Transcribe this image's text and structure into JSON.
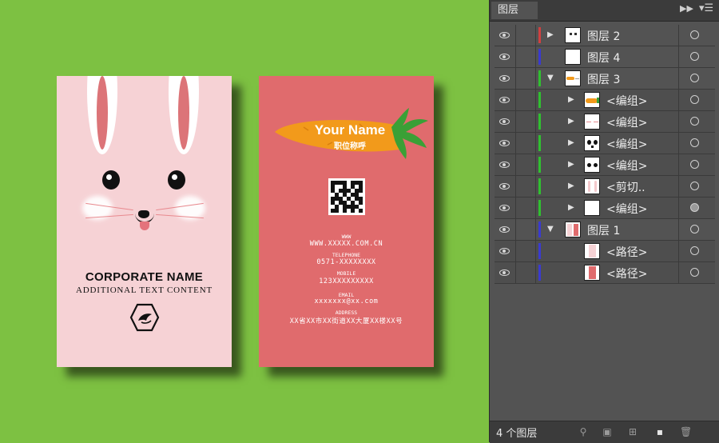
{
  "canvas": {
    "background_color": "#7dc142",
    "front_card": {
      "background_color": "#f6d2d5",
      "company_name": "CORPORATE NAME",
      "company_sub": "ADDITIONAL TEXT CONTENT"
    },
    "back_card": {
      "background_color": "#e06b6d",
      "name": "Your Name",
      "job_title": "职位称呼",
      "www_label": "WWW",
      "www_value": "WWW.XXXXX.COM.CN",
      "telephone_label": "TELEPHONE",
      "telephone_value": "0571-XXXXXXXX",
      "mobile_label": "MOBILE",
      "mobile_value": "123XXXXXXXXX",
      "email_label": "EMAIL",
      "email_value": "xxxxxxx@xx.com",
      "address_label": "ADDRESS",
      "address_value": "XX省XX市XX街道XX大厦XX楼XX号"
    }
  },
  "layers_panel": {
    "tab_label": "图层",
    "collapse_icon": "double-chevron-right-icon",
    "menu_icon": "panel-menu-icon",
    "layers": [
      {
        "name": "图层 2",
        "color": "#d04040",
        "expanded": false,
        "level": 0,
        "thumb": "small-dots"
      },
      {
        "name": "图层 4",
        "color": "#3a3ad0",
        "expanded": null,
        "level": 0,
        "thumb": "blank"
      },
      {
        "name": "图层 3",
        "color": "#30c030",
        "expanded": true,
        "level": 0,
        "thumb": "carrot-small"
      },
      {
        "name": "<编组>",
        "color": "#30c030",
        "expanded": false,
        "level": 1,
        "thumb": "carrot"
      },
      {
        "name": "<编组>",
        "color": "#30c030",
        "expanded": false,
        "level": 1,
        "thumb": "whiskers"
      },
      {
        "name": "<编组>",
        "color": "#30c030",
        "expanded": false,
        "level": 1,
        "thumb": "eyes"
      },
      {
        "name": "<编组>",
        "color": "#30c030",
        "expanded": false,
        "level": 1,
        "thumb": "dots"
      },
      {
        "name": "<剪切..",
        "color": "#30c030",
        "expanded": false,
        "level": 1,
        "thumb": "ears"
      },
      {
        "name": "<编组>",
        "color": "#30c030",
        "expanded": false,
        "level": 1,
        "thumb": "blank",
        "target_filled": true
      },
      {
        "name": "图层 1",
        "color": "#3a3ad0",
        "expanded": true,
        "level": 0,
        "thumb": "cards"
      },
      {
        "name": "<路径>",
        "color": "#3a3ad0",
        "expanded": null,
        "level": 1,
        "thumb": "pink-card"
      },
      {
        "name": "<路径>",
        "color": "#3a3ad0",
        "expanded": null,
        "level": 1,
        "thumb": "red-card"
      }
    ],
    "footer": {
      "layer_count": "4 个图层",
      "icons": [
        "locate-object-icon",
        "make-clipping-mask-icon",
        "create-sublayer-icon",
        "new-layer-icon",
        "delete-layer-icon"
      ]
    }
  }
}
